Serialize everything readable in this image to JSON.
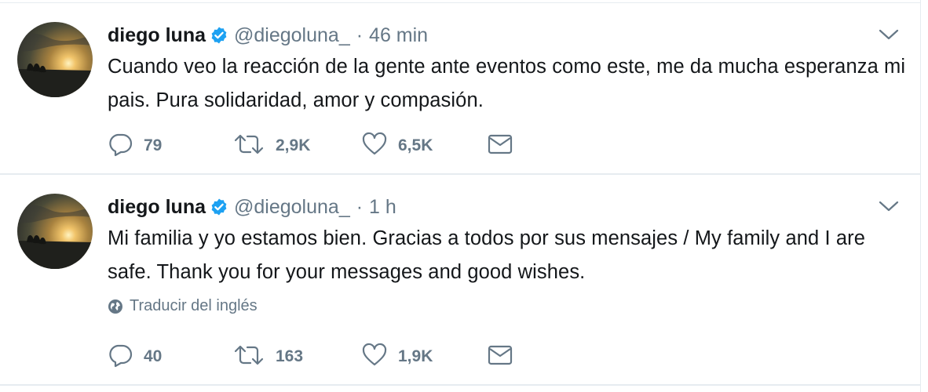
{
  "tweets": [
    {
      "author_name": "diego luna",
      "handle": "@diegoluna_",
      "separator": "·",
      "time": "46 min",
      "text": "Cuando veo la reacción de la gente ante eventos como este, me da mucha esperanza mi pais. Pura solidaridad, amor y compasión.",
      "translate_label": "",
      "replies": "79",
      "retweets": "2,9K",
      "likes": "6,5K"
    },
    {
      "author_name": "diego luna",
      "handle": "@diegoluna_",
      "separator": "·",
      "time": "1 h",
      "text": "Mi familia y yo estamos bien. Gracias a todos por sus mensajes / My family and I are safe. Thank you for your messages and good wishes.",
      "translate_label": "Traducir del inglés",
      "replies": "40",
      "retweets": "163",
      "likes": "1,9K"
    }
  ],
  "colors": {
    "text_primary": "#14171a",
    "text_secondary": "#657786",
    "verified_blue": "#1da1f2",
    "divider": "#e6ecf0"
  },
  "icons": {
    "reply": "reply-icon",
    "retweet": "retweet-icon",
    "like": "heart-icon",
    "dm": "envelope-icon",
    "verified": "verified-badge-icon",
    "more": "chevron-down-icon",
    "translate": "globe-icon"
  }
}
